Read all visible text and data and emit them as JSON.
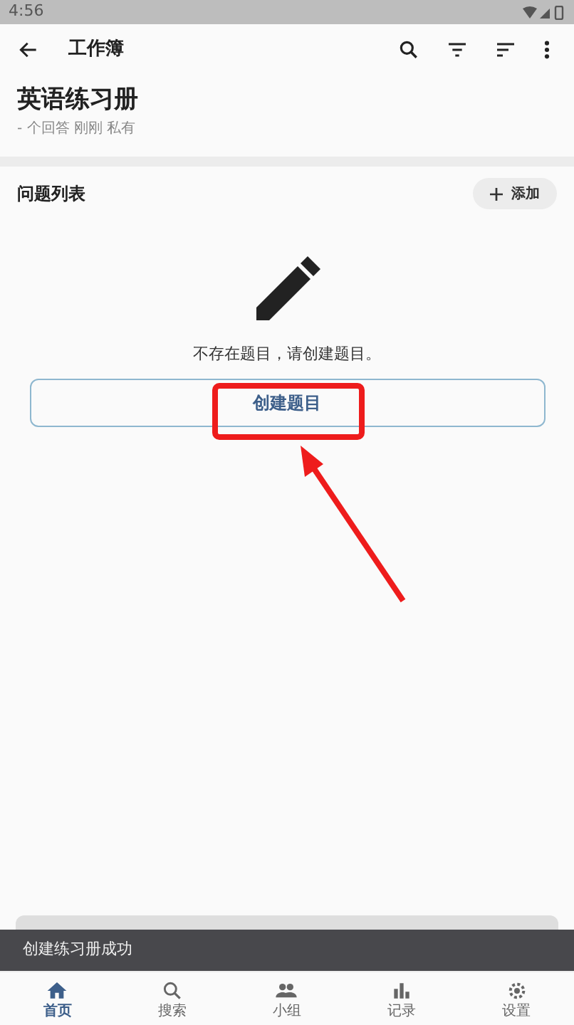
{
  "status_bar": {
    "time": "4:56"
  },
  "app_bar": {
    "title": "工作簿"
  },
  "workbook": {
    "title": "英语练习册",
    "meta": "- 个回答 刚刚 私有"
  },
  "questions": {
    "title": "问题列表",
    "add_button": "添加",
    "empty_message": "不存在题目，请创建题目。",
    "create_button": "创建题目"
  },
  "annotation": {
    "kind": "highlight-arrow"
  },
  "snackbar": {
    "message": "创建练习册成功"
  },
  "bottom_nav": [
    {
      "label": "首页",
      "kind": "home",
      "selected": true
    },
    {
      "label": "搜索",
      "kind": "search",
      "selected": false
    },
    {
      "label": "小组",
      "kind": "group",
      "selected": false
    },
    {
      "label": "记录",
      "kind": "record",
      "selected": false
    },
    {
      "label": "设置",
      "kind": "settings",
      "selected": false
    }
  ]
}
